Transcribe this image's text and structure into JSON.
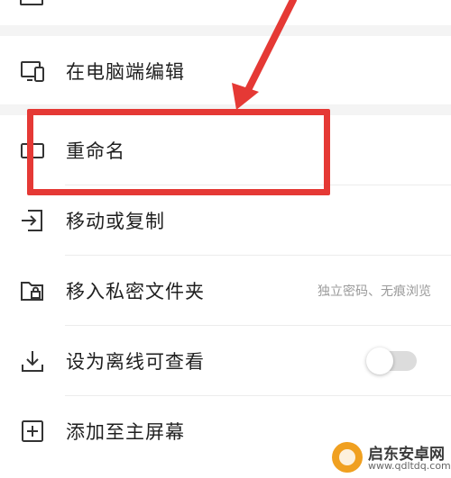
{
  "menu": {
    "items": [
      {
        "label": "在电脑端编辑",
        "icon": "device-edit-icon"
      },
      {
        "label": "重命名",
        "icon": "rename-icon"
      },
      {
        "label": "移动或复制",
        "icon": "move-icon"
      },
      {
        "label": "移入私密文件夹",
        "icon": "private-folder-icon",
        "hint": "独立密码、无痕浏览"
      },
      {
        "label": "设为离线可查看",
        "icon": "download-icon",
        "toggle_on": false
      },
      {
        "label": "添加至主屏幕",
        "icon": "add-square-icon"
      }
    ]
  },
  "annotation": {
    "color": "#e53935"
  },
  "watermark": {
    "name": "启东安卓网",
    "url": "www.qdltdq.com"
  }
}
